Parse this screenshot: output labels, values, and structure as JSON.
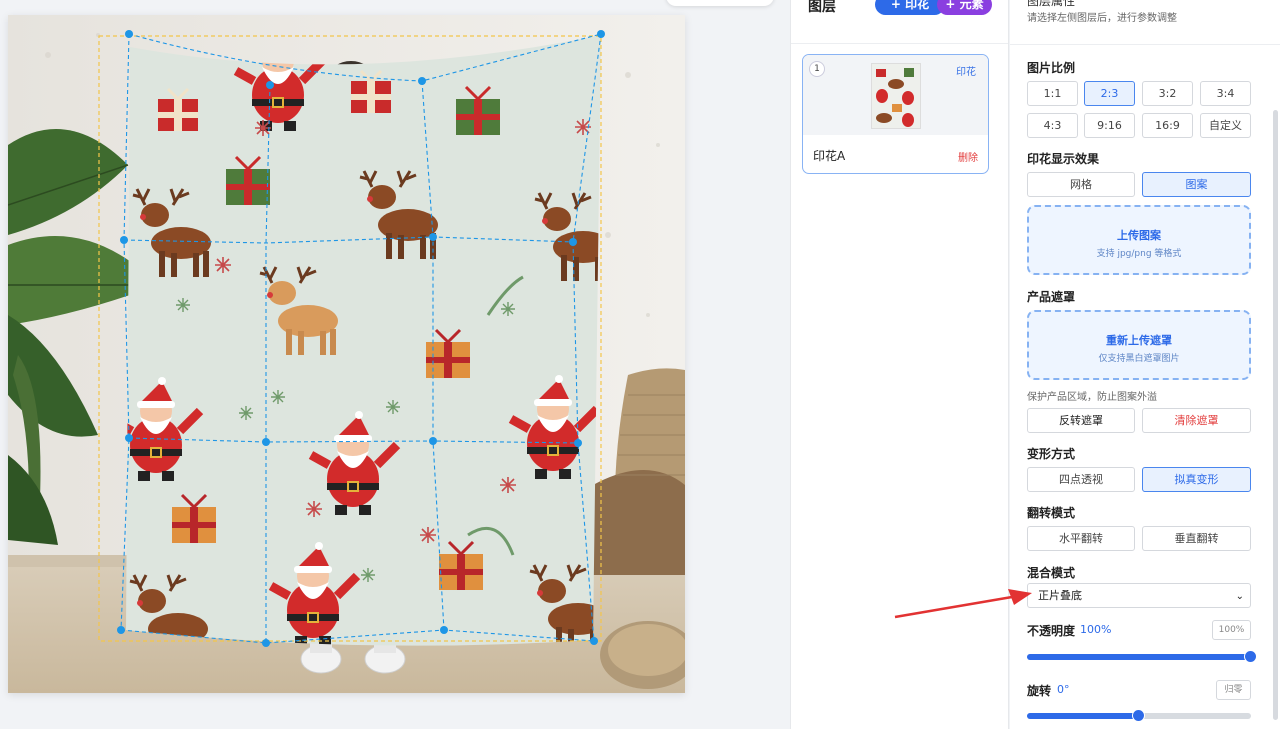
{
  "layers_panel": {
    "title": "图层",
    "add_print_button": "+ 印花",
    "add_element_button": "+ 元素",
    "layer": {
      "index": "1",
      "tag": "印花",
      "name": "印花A",
      "delete_label": "删除"
    }
  },
  "props_panel": {
    "header_partial": "图层属性",
    "hint": "请选择左侧图层后，进行参数调整",
    "ratio": {
      "label": "图片比例",
      "options": [
        "1:1",
        "2:3",
        "3:2",
        "3:4",
        "4:3",
        "9:16",
        "16:9",
        "自定义"
      ],
      "selected": "2:3"
    },
    "display_effect": {
      "label": "印花显示效果",
      "options": [
        "网格",
        "图案"
      ],
      "selected": "图案"
    },
    "upload_pattern": {
      "title": "上传图案",
      "subtitle": "支持 jpg/png 等格式"
    },
    "mask": {
      "label": "产品遮罩",
      "upload_title": "重新上传遮罩",
      "upload_subtitle": "仅支持黑白遮罩图片",
      "note": "保护产品区域，防止图案外溢",
      "invert_button": "反转遮罩",
      "clear_button": "清除遮罩"
    },
    "transform": {
      "label": "变形方式",
      "options": [
        "四点透视",
        "拟真变形"
      ],
      "selected": "拟真变形"
    },
    "flip": {
      "label": "翻转模式",
      "options": [
        "水平翻转",
        "垂直翻转"
      ]
    },
    "blend": {
      "label": "混合模式",
      "value": "正片叠底"
    },
    "opacity": {
      "label": "不透明度",
      "value_text": "100%",
      "value": 100,
      "max": 100,
      "reset_label": "100%"
    },
    "rotation": {
      "label": "旋转",
      "value_text": "0°",
      "value": 0,
      "min": -180,
      "max": 180,
      "reset_label": "归零"
    }
  },
  "colors": {
    "accent": "#2d6ae8",
    "element_purple": "#8a3fe0",
    "danger": "#e23b3b",
    "guide_blue": "#1e96e6",
    "bbox_yellow": "#f3c54a",
    "blanket_bg": "#dde5de"
  }
}
